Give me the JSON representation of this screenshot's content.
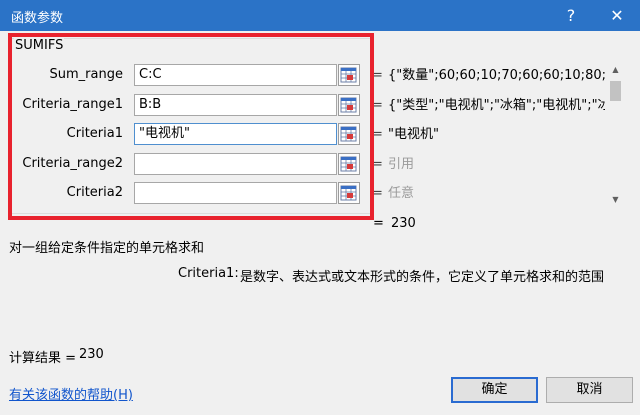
{
  "window": {
    "title": "函数参数",
    "help_glyph": "?",
    "close_glyph": "✕"
  },
  "function_name": "SUMIFS",
  "arguments": [
    {
      "label": "Sum_range",
      "value": "C:C",
      "equals": "=",
      "preview": "{\"数量\";60;60;10;70;60;60;10;80;9...",
      "preview_gray": false
    },
    {
      "label": "Criteria_range1",
      "value": "B:B",
      "equals": "=",
      "preview": "{\"类型\";\"电视机\";\"冰箱\";\"电视机\";\"冰箱",
      "preview_gray": false
    },
    {
      "label": "Criteria1",
      "value": "\"电视机\"",
      "equals": "=",
      "preview": "\"电视机\"",
      "preview_gray": false
    },
    {
      "label": "Criteria_range2",
      "value": "",
      "equals": "=",
      "preview": "引用",
      "preview_gray": true
    },
    {
      "label": "Criteria2",
      "value": "",
      "equals": "=",
      "preview": "任意",
      "preview_gray": true
    }
  ],
  "result": {
    "equals": "=",
    "value": "230"
  },
  "description": "对一组给定条件指定的单元格求和",
  "current_argument": {
    "name": "Criteria1:",
    "text": "是数字、表达式或文本形式的条件，它定义了单元格求和的范围"
  },
  "calculation": {
    "label": "计算结果 =",
    "value": "230"
  },
  "help_link": "有关该函数的帮助(H)",
  "buttons": {
    "ok": "确定",
    "cancel": "取消"
  },
  "icons": {
    "ref_picker": "range-select-icon"
  },
  "colors": {
    "titlebar": "#2b73c7",
    "highlight_box": "#e8222e",
    "link": "#1155cc",
    "default_button_border": "#2a6bd1"
  }
}
